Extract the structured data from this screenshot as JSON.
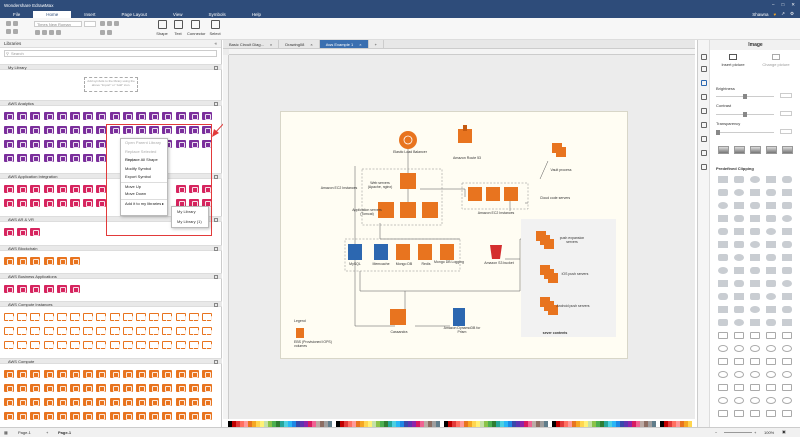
{
  "app": {
    "title": "Wondershare EdrawMax",
    "menu": [
      "File",
      "Home",
      "Insert",
      "Page Layout",
      "View",
      "Symbols",
      "Help"
    ],
    "active_menu": "Home",
    "user": "Shawna",
    "font_name": "Times New Roman",
    "ribbon_tools": [
      "Shape",
      "Text",
      "Connector",
      "Select"
    ]
  },
  "libraries": {
    "header": "Libraries",
    "search_placeholder": "Search",
    "my_library": "My Library",
    "my_library_note": "Add symbols to the library using the above \"Import\" or \"Add\" icon.",
    "sections": [
      "AWS Analytics",
      "AWS Application Integration",
      "AWS AR & VR",
      "AWS Blockchain",
      "AWS Business Applications",
      "AWS Compute Instances",
      "AWS Compute"
    ]
  },
  "context_menu": {
    "items": [
      {
        "label": "Open Parent Library",
        "disabled": true
      },
      {
        "label": "Replace Selected Shape",
        "disabled": true
      },
      {
        "label": "Replace All Shape",
        "disabled": false
      },
      {
        "label": "Modify Symbol",
        "disabled": false
      },
      {
        "label": "Export Symbol",
        "disabled": false
      },
      {
        "label": "Move Up",
        "disabled": false
      },
      {
        "label": "Move Down",
        "disabled": false
      },
      {
        "label": "Add it to my libraries",
        "disabled": false
      }
    ],
    "submenu": [
      "My Library",
      "My Library (1)"
    ]
  },
  "tabs": [
    "Basic Circuit Diag...",
    "Drawing08",
    "Aws Example 1"
  ],
  "active_tab": "Aws Example 1",
  "diagram": {
    "labels": {
      "elb": "Elastic Load Balancer",
      "route53": "Amazon Route 53",
      "ec2_left": "Amazon EC2 Instances",
      "web_servers": "Web servers (Apache, nginx)",
      "app_servers": "Application servers (Tomcat)",
      "ec2_mid": "Amazon EC2 Instances",
      "vault": "Vault process",
      "cloud_code": "Cloud code servers",
      "mysql": "MySQL",
      "memcache": "Memcache",
      "mongodb": "Mongo DB",
      "redis": "Redis",
      "mongo_logging": "Mongo DB Logging",
      "s3": "Amazon S3 bucket",
      "push_exp": "push expansion servers",
      "ios_push": "iOS push servers",
      "android_push": "Android push servers",
      "server_contents": "sever contents",
      "cassandra": "Cassandra",
      "dynamodb": "Amazon DynamoDB for Prism",
      "legend": "Legend",
      "ebs": "EBS (Provisioned IOPS) volumes"
    }
  },
  "format_panel": {
    "title": "Image",
    "insert_picture": "Insert picture",
    "change_picture": "Change picture",
    "brightness": "Brightness",
    "contrast": "Contrast",
    "transparency": "Transparency",
    "predefined_clipping": "Predefined Clipping"
  },
  "status": {
    "page_tab": "Page-1",
    "page_tab_active": "Page-1",
    "zoom": "100%"
  },
  "colors": {
    "aws_analytics": "#7b2f9c",
    "aws_app_integration": "#d6255f",
    "aws_compute": "#e8741f",
    "accent": "#2e4c7a",
    "highlight": "#e23a3a"
  }
}
